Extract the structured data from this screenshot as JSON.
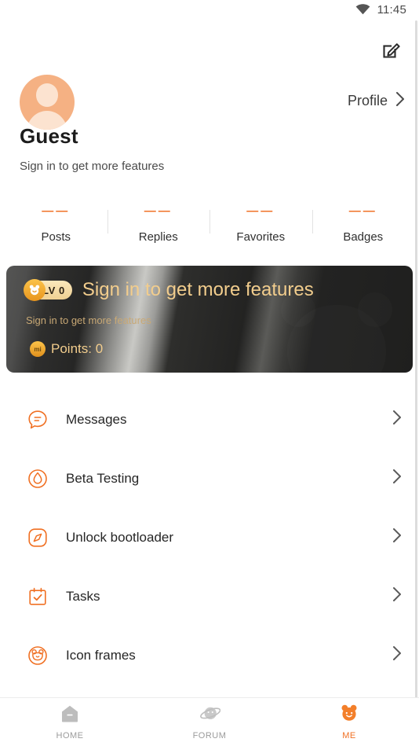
{
  "status_bar": {
    "wifi_icon": "wifi-icon",
    "time": "11:45"
  },
  "header": {
    "edit_icon": "edit-square-pen-icon",
    "profile_label": "Profile",
    "profile_chevron_icon": "chevron-right-icon",
    "avatar_icon": "default-avatar-icon"
  },
  "user": {
    "name": "Guest",
    "subtitle": "Sign in to get more features"
  },
  "stats": [
    {
      "value": "——",
      "label": "Posts"
    },
    {
      "value": "——",
      "label": "Replies"
    },
    {
      "value": "——",
      "label": "Favorites"
    },
    {
      "value": "——",
      "label": "Badges"
    }
  ],
  "level_card": {
    "level_badge_icon": "bear-coin-icon",
    "level_badge_text": "LV 0",
    "title": "Sign in to get more features",
    "subtitle": "Sign in to get more features",
    "points_icon": "mi-coin-icon",
    "points_text": "Points: 0",
    "watermark_icon": "bear-head-silhouette-icon"
  },
  "menu": [
    {
      "icon": "message-bubble-icon",
      "label": "Messages",
      "chevron": "chevron-right-icon"
    },
    {
      "icon": "beta-droplet-icon",
      "label": "Beta Testing",
      "chevron": "chevron-right-icon"
    },
    {
      "icon": "unlock-bootloader-compass-icon",
      "label": "Unlock bootloader",
      "chevron": "chevron-right-icon"
    },
    {
      "icon": "calendar-check-icon",
      "label": "Tasks",
      "chevron": "chevron-right-icon"
    },
    {
      "icon": "bear-circle-icon",
      "label": "Icon frames",
      "chevron": "chevron-right-icon"
    }
  ],
  "bottom_nav": [
    {
      "icon": "home-icon",
      "label": "HOME",
      "active": false
    },
    {
      "icon": "planet-forum-icon",
      "label": "FORUM",
      "active": false
    },
    {
      "icon": "bear-me-icon",
      "label": "ME",
      "active": true
    }
  ],
  "colors": {
    "accent": "#f07023",
    "gold": "#f2cd8d",
    "avatar": "#f5b183",
    "nav_inactive": "#9b9b9b",
    "text_primary": "#1c1c1c"
  }
}
